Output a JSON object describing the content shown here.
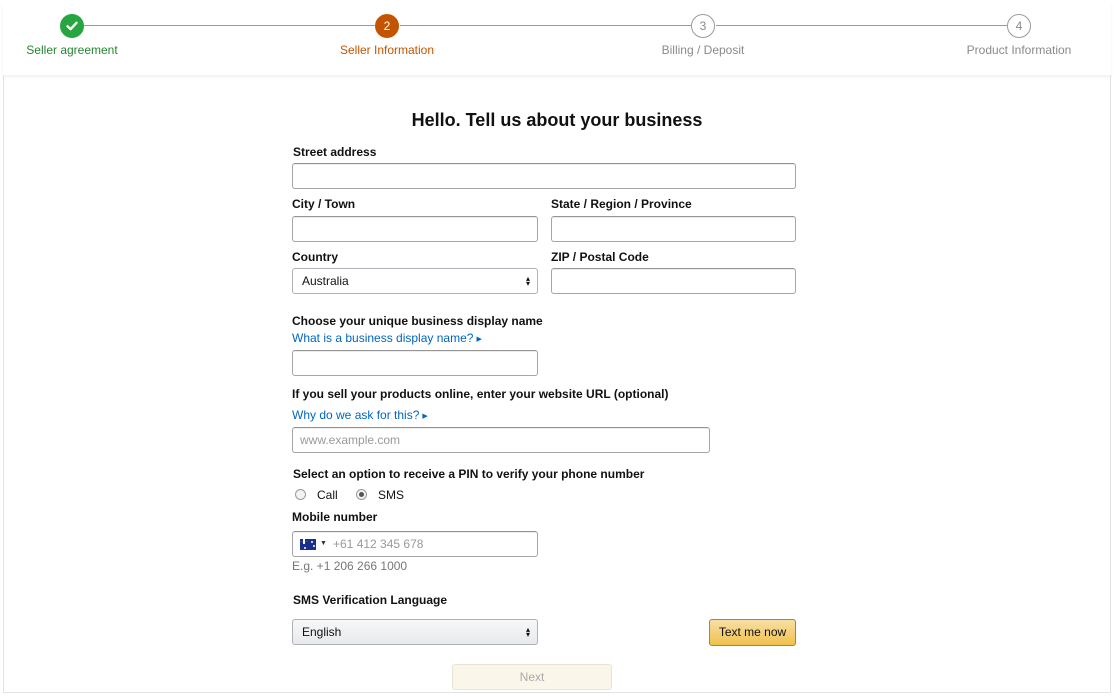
{
  "steps": [
    {
      "label": "Seller agreement",
      "number": "",
      "state": "done"
    },
    {
      "label": "Seller Information",
      "number": "2",
      "state": "current"
    },
    {
      "label": "Billing / Deposit",
      "number": "3",
      "state": "todo"
    },
    {
      "label": "Product Information",
      "number": "4",
      "state": "todo"
    }
  ],
  "page_title": "Hello. Tell us about your business",
  "address": {
    "street_label": "Street address",
    "street_value": "",
    "city_label": "City / Town",
    "city_value": "",
    "state_label": "State / Region / Province",
    "state_value": "",
    "country_label": "Country",
    "country_value": "Australia",
    "zip_label": "ZIP / Postal Code",
    "zip_value": ""
  },
  "display_name": {
    "label": "Choose your unique business display name",
    "help_link": "What is a business display name?",
    "value": ""
  },
  "website": {
    "label": "If you sell your products online, enter your website URL (optional)",
    "help_link": "Why do we ask for this?",
    "placeholder": "www.example.com"
  },
  "pin": {
    "label": "Select an option to receive a PIN to verify your phone number",
    "options": [
      {
        "label": "Call",
        "checked": false
      },
      {
        "label": "SMS",
        "checked": true
      }
    ]
  },
  "mobile": {
    "label": "Mobile number",
    "country_icon": "australia-flag-icon",
    "placeholder": "+61 412 345 678",
    "example": "E.g. +1 206 266 1000"
  },
  "sms_language": {
    "label": "SMS Verification Language",
    "value": "English",
    "button_label": "Text me now"
  },
  "next_label": "Next",
  "colors": {
    "done": "#26a541",
    "current": "#c45500",
    "link": "#0066c0",
    "button": "#f0c14b"
  }
}
